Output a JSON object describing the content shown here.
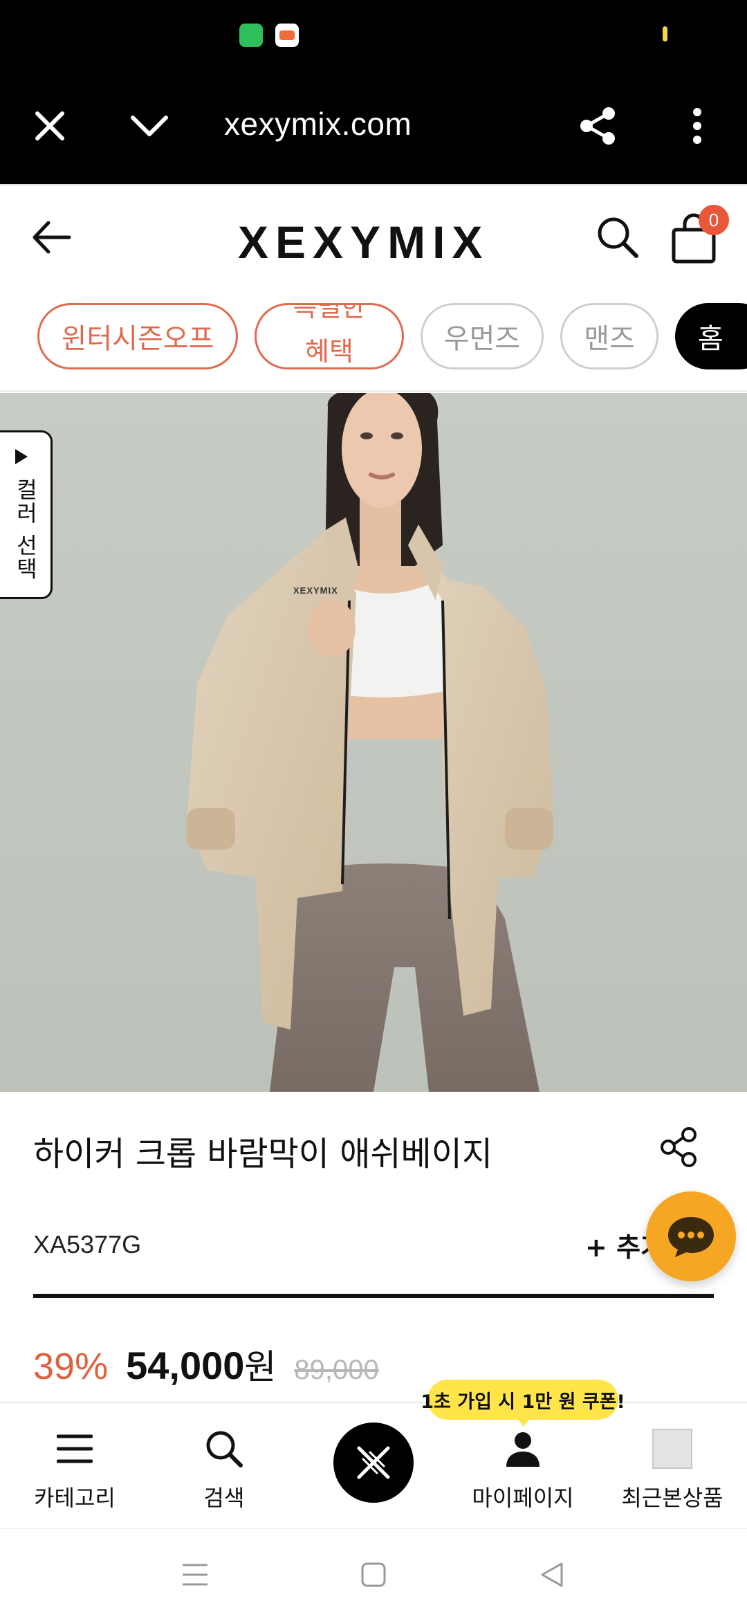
{
  "status_bar": {
    "icons": [
      "messages-app-icon",
      "gallery-app-icon"
    ]
  },
  "browser": {
    "url": "xexymix.com",
    "icons": [
      "close-icon",
      "chevron-down-icon",
      "share-icon",
      "more-vert-icon"
    ]
  },
  "header": {
    "logo_text": "XEXYMIX",
    "cart_count": "0",
    "icons": [
      "back-arrow-icon",
      "search-icon",
      "cart-icon"
    ]
  },
  "chips": [
    {
      "label": "윈터시즌오프",
      "style": "orange"
    },
    {
      "label": "특별한 혜택",
      "style": "orange"
    },
    {
      "label": "우먼즈",
      "style": "gray"
    },
    {
      "label": "맨즈",
      "style": "gray"
    },
    {
      "label": "홈",
      "style": "black"
    }
  ],
  "hero": {
    "color_select_label": "컬러 선택",
    "jacket_logo": "XEXYMIX"
  },
  "product": {
    "title": "하이커 크롭 바람막이 애쉬베이지",
    "sku": "XA5377G",
    "add_label": "+ 추가",
    "discount": "39%",
    "price": "54,000",
    "currency": "원",
    "original_price": "89,000"
  },
  "promo": {
    "text": "1초 가입 시 1만 원 쿠폰!"
  },
  "bottom_nav": [
    {
      "label": "카테고리",
      "icon": "menu-icon"
    },
    {
      "label": "검색",
      "icon": "search-icon"
    },
    {
      "label": "",
      "icon": "xexymix-logo-icon"
    },
    {
      "label": "마이페이지",
      "icon": "user-icon"
    },
    {
      "label": "최근본상품",
      "icon": "recent-product-icon"
    }
  ],
  "colors": {
    "accent_orange": "#e06a4e",
    "promo_yellow": "#ffe44a",
    "chat_orange": "#f5a623",
    "cart_badge": "#e9563a"
  }
}
